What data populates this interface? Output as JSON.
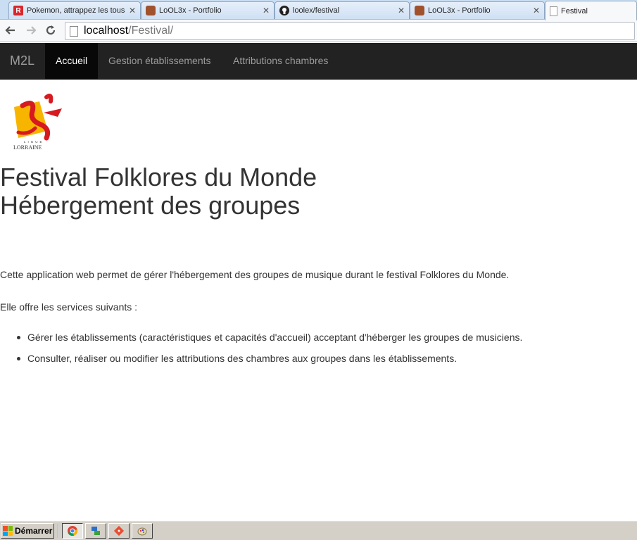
{
  "browser": {
    "tabs": [
      {
        "label": "Pokemon, attrappez les tous",
        "favicon": "r-icon",
        "color": "#d8262c"
      },
      {
        "label": "LoOL3x - Portfolio",
        "favicon": "avatar-icon",
        "color": "#a0522d"
      },
      {
        "label": "loolex/festival",
        "favicon": "github-icon",
        "color": "#222222"
      },
      {
        "label": "LoOL3x - Portfolio",
        "favicon": "avatar-icon",
        "color": "#a0522d"
      },
      {
        "label": "Festival",
        "favicon": "page-icon",
        "color": "#ffffff"
      }
    ],
    "tab_close": "✕",
    "url_host": "localhost",
    "url_path": "/Festival/"
  },
  "navbar": {
    "brand": "M2L",
    "items": [
      "Accueil",
      "Gestion établissements",
      "Attributions chambres"
    ]
  },
  "logo": {
    "text_top": "LIGUE",
    "text_bottom": "LORRAINE"
  },
  "content": {
    "title_line1": "Festival Folklores du Monde",
    "title_line2": "Hébergement des groupes",
    "intro": "Cette application web permet de gérer l'hébergement des groupes de musique durant le festival Folklores du Monde.",
    "services_intro": "Elle offre les services suivants :",
    "services": [
      "Gérer les établissements (caractéristiques et capacités d'accueil) acceptant d'héberger les groupes de musiciens.",
      "Consulter, réaliser ou modifier les attributions des chambres aux groupes dans les établissements."
    ]
  },
  "taskbar": {
    "start_label": "Démarrer",
    "quick_launch": [
      "chrome-icon",
      "network-icon",
      "git-icon",
      "paint-icon"
    ]
  },
  "colors": {
    "navbar_bg": "#222222",
    "logo_red": "#d71920",
    "logo_yellow": "#f7b500"
  }
}
